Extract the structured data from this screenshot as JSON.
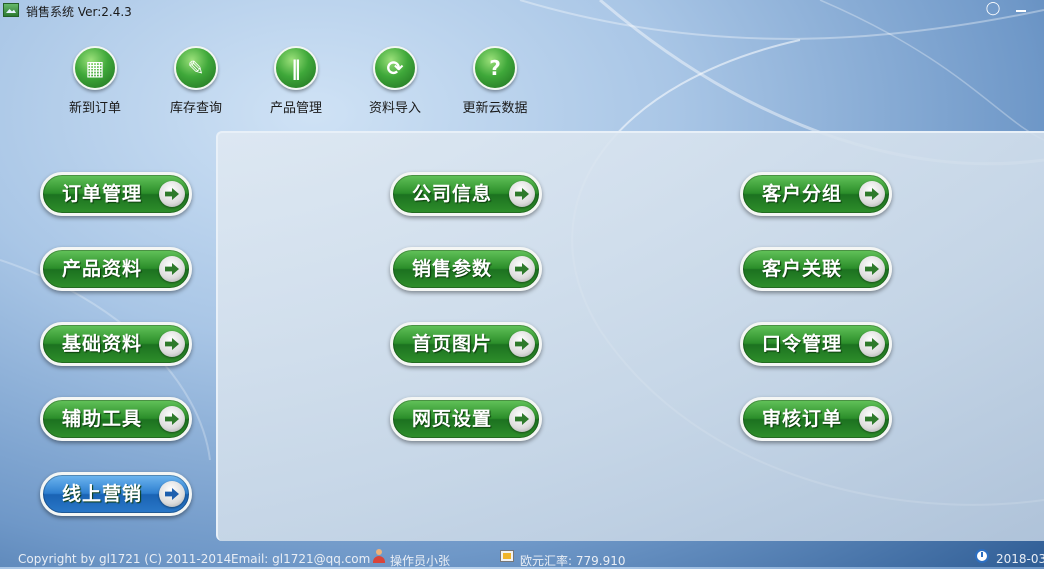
{
  "window": {
    "title": "销售系统 Ver:2.4.3",
    "skin_icon": "shirt-icon",
    "minimize_icon": "minimize-icon"
  },
  "toolbar": [
    {
      "label": "新到订单",
      "icon": "new-order-icon"
    },
    {
      "label": "库存查询",
      "icon": "inventory-search-icon"
    },
    {
      "label": "产品管理",
      "icon": "product-manage-icon"
    },
    {
      "label": "资料导入",
      "icon": "import-icon"
    },
    {
      "label": "更新云数据",
      "icon": "cloud-update-icon"
    }
  ],
  "left_menu": [
    {
      "label": "订单管理"
    },
    {
      "label": "产品资料"
    },
    {
      "label": "基础资料"
    },
    {
      "label": "辅助工具"
    },
    {
      "label": "线上营销"
    }
  ],
  "middle_menu": [
    {
      "label": "公司信息"
    },
    {
      "label": "销售参数"
    },
    {
      "label": "首页图片"
    },
    {
      "label": "网页设置"
    }
  ],
  "right_menu": [
    {
      "label": "客户分组"
    },
    {
      "label": "客户关联"
    },
    {
      "label": "口令管理"
    },
    {
      "label": "审核订单"
    }
  ],
  "status": {
    "copyright": "Copyright by gl1721 (C) 2011-2014",
    "email": "Email: gl1721@qq.com",
    "operator": "操作员小张",
    "exchange_rate": "欧元汇率: 779.910",
    "datetime": "2018-03"
  },
  "colors": {
    "pill_green": "#2b8e2a",
    "pill_blue": "#2e7fd0",
    "panel": "#d4e0ec"
  }
}
